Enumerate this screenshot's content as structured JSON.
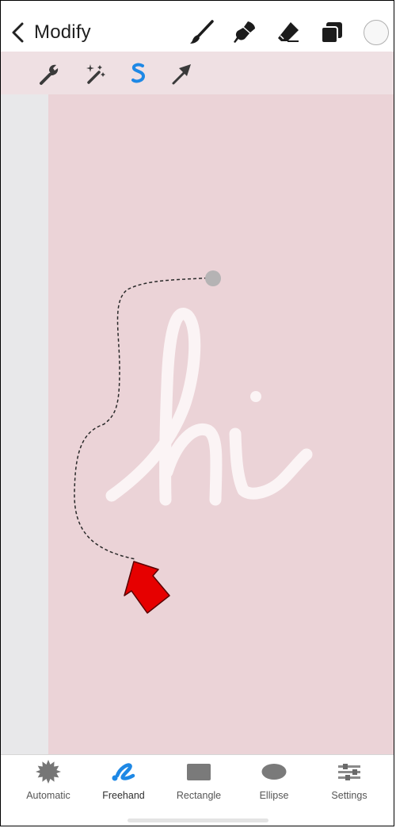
{
  "header": {
    "back_label": "Modify",
    "tools": [
      "brush-icon",
      "smudge-icon",
      "eraser-icon",
      "layers-icon",
      "color-swatch"
    ]
  },
  "adjust_toolbar": {
    "tools": [
      "wrench-icon",
      "magic-wand-icon",
      "selection-icon",
      "transform-arrow-icon"
    ],
    "active_tool": "selection-icon",
    "active_color": "#1e88e5"
  },
  "canvas": {
    "background_color": "#ebd3d7",
    "lettering_color": "#fbf4f5",
    "annotation_arrow_color": "#e60000"
  },
  "selection_modes": {
    "active": "Freehand",
    "items": [
      {
        "label": "Automatic",
        "icon": "starburst-icon"
      },
      {
        "label": "Freehand",
        "icon": "freehand-icon"
      },
      {
        "label": "Rectangle",
        "icon": "rectangle-icon"
      },
      {
        "label": "Ellipse",
        "icon": "ellipse-icon"
      },
      {
        "label": "Settings",
        "icon": "sliders-icon"
      }
    ]
  }
}
